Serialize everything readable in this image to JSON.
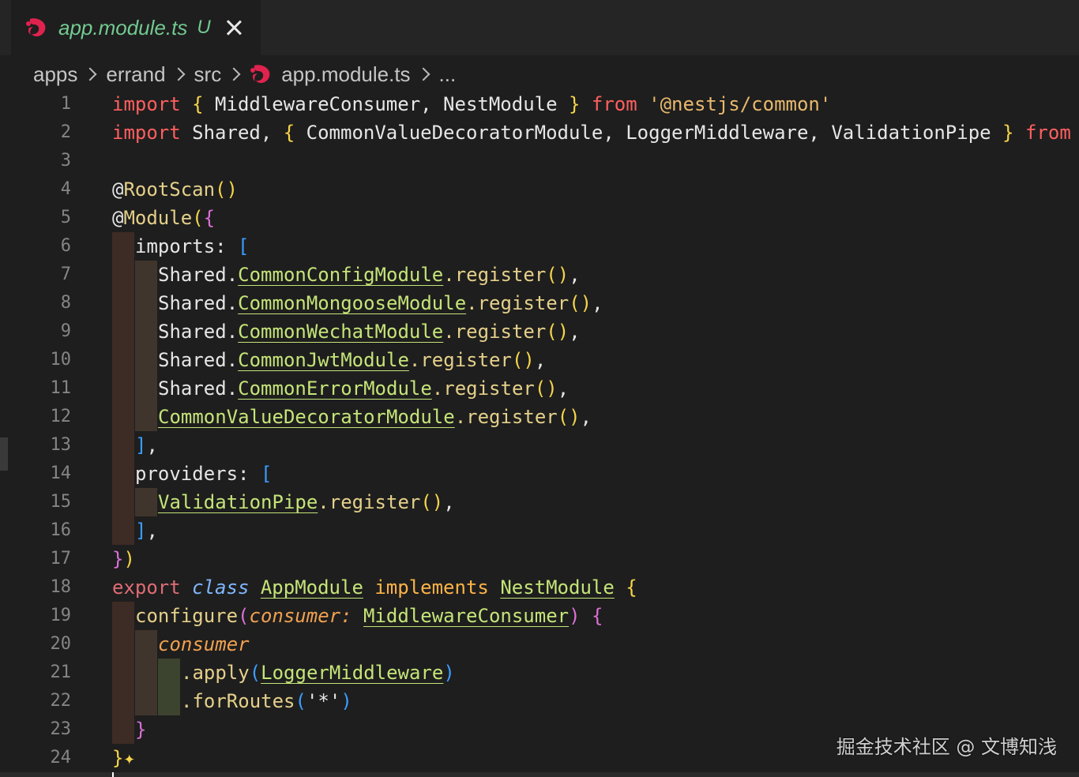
{
  "tab": {
    "filename": "app.module.ts",
    "status": "U",
    "icon": "nestjs-icon"
  },
  "breadcrumb": {
    "items": [
      "apps",
      "errand",
      "src",
      "app.module.ts",
      "..."
    ]
  },
  "lines": [
    {
      "n": "1"
    },
    {
      "n": "2"
    },
    {
      "n": "3"
    },
    {
      "n": "4"
    },
    {
      "n": "5"
    },
    {
      "n": "6"
    },
    {
      "n": "7"
    },
    {
      "n": "8"
    },
    {
      "n": "9"
    },
    {
      "n": "10"
    },
    {
      "n": "11"
    },
    {
      "n": "12"
    },
    {
      "n": "13"
    },
    {
      "n": "14"
    },
    {
      "n": "15"
    },
    {
      "n": "16"
    },
    {
      "n": "17"
    },
    {
      "n": "18"
    },
    {
      "n": "19"
    },
    {
      "n": "20"
    },
    {
      "n": "21"
    },
    {
      "n": "22"
    },
    {
      "n": "23"
    },
    {
      "n": "24"
    }
  ],
  "code": {
    "l1": [
      "import",
      " ",
      "{",
      " MiddlewareConsumer, NestModule ",
      "}",
      " ",
      "from",
      " ",
      "'@nestjs/common'"
    ],
    "l2": [
      "import",
      " Shared, ",
      "{",
      " CommonValueDecoratorModule, LoggerMiddleware, ValidationPipe ",
      "}",
      " ",
      "from"
    ],
    "l4": [
      "@",
      "RootScan",
      "()"
    ],
    "l5": [
      "@",
      "Module",
      "(",
      "{"
    ],
    "l6": [
      "imports: ",
      "["
    ],
    "l7": [
      "Shared.",
      "CommonConfigModule",
      ".register",
      "()",
      ","
    ],
    "l8": [
      "Shared.",
      "CommonMongooseModule",
      ".register",
      "()",
      ","
    ],
    "l9": [
      "Shared.",
      "CommonWechatModule",
      ".register",
      "()",
      ","
    ],
    "l10": [
      "Shared.",
      "CommonJwtModule",
      ".register",
      "()",
      ","
    ],
    "l11": [
      "Shared.",
      "CommonErrorModule",
      ".register",
      "()",
      ","
    ],
    "l12": [
      "CommonValueDecoratorModule",
      ".register",
      "()",
      ","
    ],
    "l13": [
      "]",
      ","
    ],
    "l14": [
      "providers: ",
      "["
    ],
    "l15": [
      "ValidationPipe",
      ".register",
      "()",
      ","
    ],
    "l16": [
      "]",
      ","
    ],
    "l17": [
      "}",
      ")"
    ],
    "l18": [
      "export",
      " ",
      "class",
      " ",
      "AppModule",
      " ",
      "implements",
      " ",
      "NestModule",
      " ",
      "{"
    ],
    "l19": [
      "configure",
      "(",
      "consumer",
      ": ",
      "MiddlewareConsumer",
      ")",
      " ",
      "{"
    ],
    "l20": [
      "consumer"
    ],
    "l21": [
      ".apply",
      "(",
      "LoggerMiddleware",
      ")"
    ],
    "l22": [
      ".forRoutes",
      "(",
      "'*'",
      ")"
    ],
    "l23": [
      "}"
    ],
    "l24": [
      "}",
      "✦"
    ]
  },
  "watermark": "掘金技术社区 @ 文博知浅",
  "colors": {
    "background": "#1e1e1e",
    "keyword": "#ff5f5f",
    "string": "#e9b96e",
    "type": "#c5e478",
    "brace_yellow": "#f6d44a",
    "brace_pink": "#da70d6",
    "brace_blue": "#3b9cff",
    "untracked": "#73c991"
  }
}
